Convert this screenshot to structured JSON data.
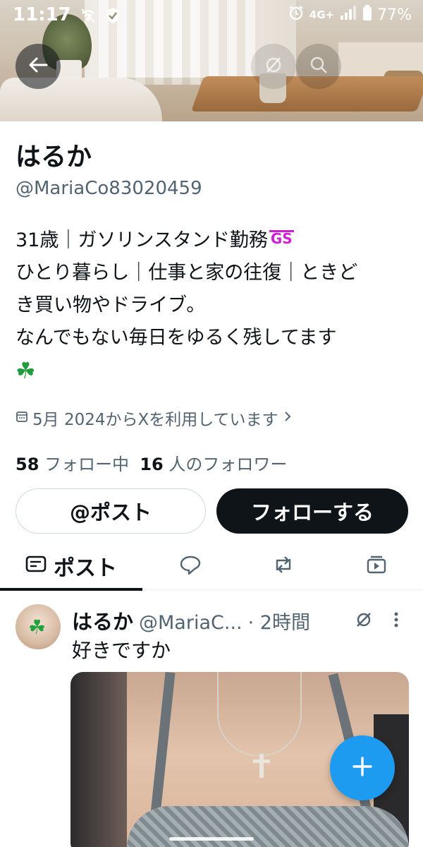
{
  "status_bar": {
    "time": "11:17",
    "network": "4G+",
    "battery": "77%"
  },
  "profile": {
    "display_name": "はるか",
    "handle": "@MariaCo83020459",
    "bio_line1": "31歳｜ガソリンスタンド勤務",
    "bio_gs": "GS",
    "bio_line2": "ひとり暮らし｜仕事と家の往復｜ときど",
    "bio_line3": "き買い物やドライブ。",
    "bio_line4": "なんでもない毎日をゆるく残してます",
    "bio_emoji": "☘",
    "joined": "5月 2024からXを利用しています",
    "following_count": "58",
    "following_label": "フォロー中",
    "followers_count": "16",
    "followers_label": "人のフォロワー"
  },
  "actions": {
    "post_label": "@ポスト",
    "follow_label": "フォローする"
  },
  "tabs": {
    "posts_label": "ポスト"
  },
  "tweet": {
    "name": "はるか",
    "handle": "@MariaC...",
    "time": "· 2時間",
    "text": "好きですか",
    "avatar_emoji": "☘"
  },
  "colors": {
    "accent": "#1d9bf0",
    "text": "#0f1419",
    "secondary": "#536471",
    "gs_magenta": "#d21fd6"
  }
}
